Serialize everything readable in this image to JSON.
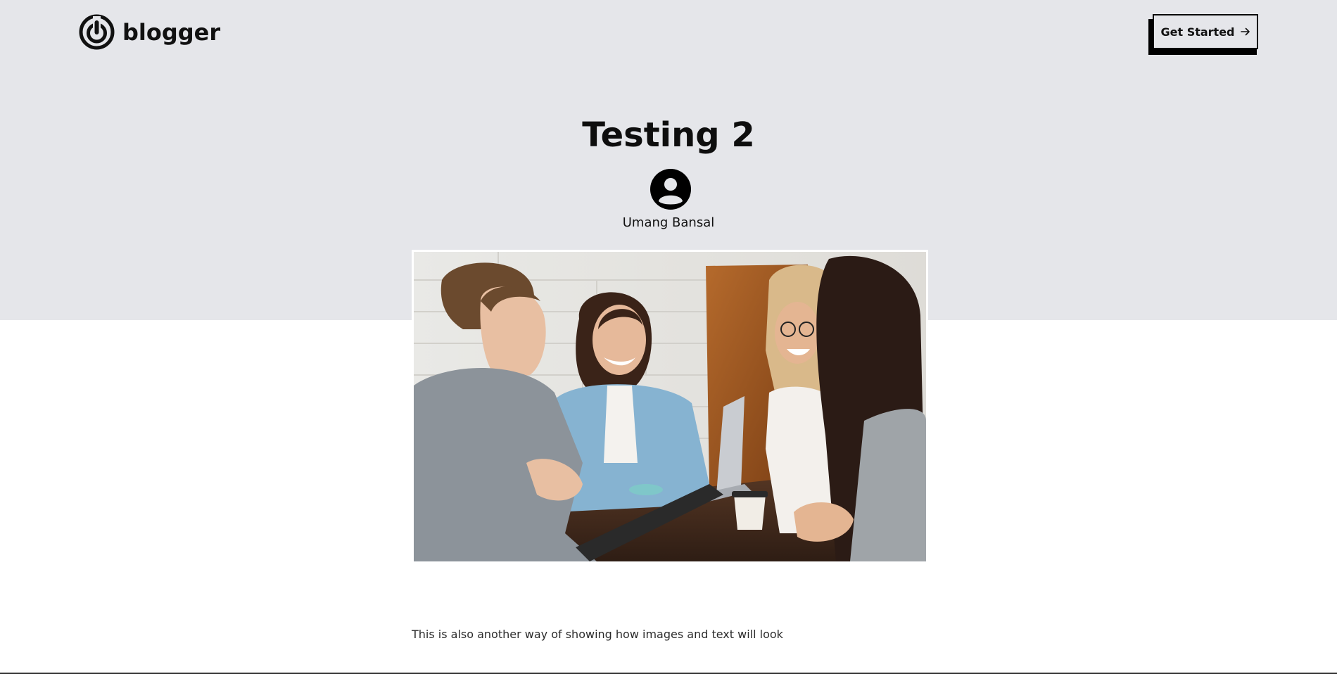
{
  "header": {
    "logo_text": "blogger",
    "logo_icon": "blogger-logo-icon",
    "cta_label": "Get Started",
    "cta_icon": "arrow-right-icon"
  },
  "post": {
    "title": "Testing 2",
    "author": "Umang Bansal",
    "author_icon": "user-avatar-icon",
    "body": "This is also another way of showing how images and text will look"
  },
  "colors": {
    "hero_background": "#e5e6ea",
    "text": "#111111",
    "accent": "#000000"
  }
}
